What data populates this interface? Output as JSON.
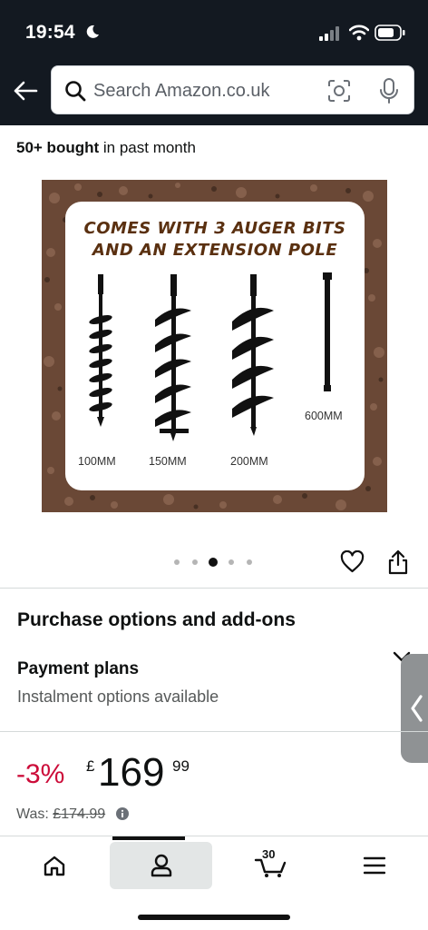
{
  "status": {
    "time": "19:54"
  },
  "search": {
    "placeholder": "Search Amazon.co.uk"
  },
  "social_proof": {
    "count": "50+ bought",
    "suffix": " in past month"
  },
  "product_image": {
    "title_line1": "COMES WITH 3 AUGER BITS",
    "title_line2": "AND AN EXTENSION POLE",
    "labels": [
      "100MM",
      "150MM",
      "200MM",
      "600MM"
    ],
    "carousel": {
      "count": 5,
      "active_index": 2
    }
  },
  "purchase": {
    "section_title": "Purchase options and add-ons",
    "plans_title": "Payment plans",
    "plans_subtitle": "Instalment options available"
  },
  "price": {
    "discount": "-3%",
    "currency": "£",
    "whole": "169",
    "fraction": "99",
    "was_label": "Was: ",
    "was_price": "£174.99"
  },
  "nav": {
    "cart_count": "30"
  },
  "colors": {
    "header_bg": "#131921",
    "discount": "#cc0c39",
    "soil": "#6a4836"
  },
  "icons": [
    "back-arrow-icon",
    "search-icon",
    "camera-icon",
    "mic-icon",
    "heart-icon",
    "share-icon",
    "chevron-down-icon",
    "chevron-left-icon",
    "info-icon",
    "home-icon",
    "account-icon",
    "cart-icon",
    "menu-icon"
  ]
}
